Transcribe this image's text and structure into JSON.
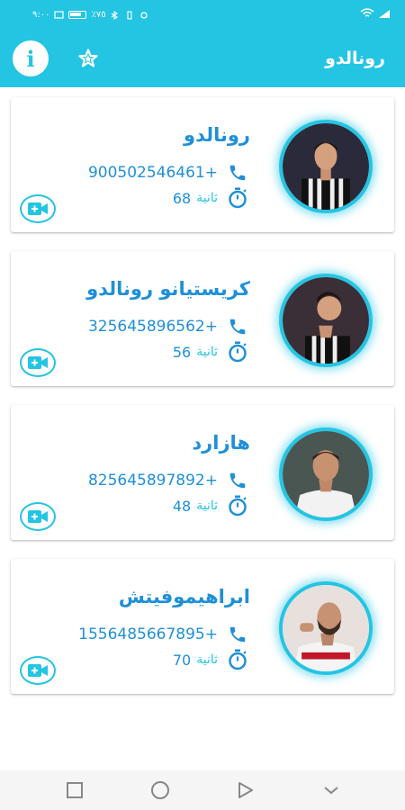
{
  "status_bar": {
    "left_text": "٩:٠٠",
    "carrier_text": "٪٧٥"
  },
  "app_bar": {
    "title": "رونالدو",
    "info_icon": "info-icon",
    "star_icon": "star-outline-icon",
    "info_label": "i"
  },
  "contacts": [
    {
      "name": "رونالدو",
      "phone": "900502546461+",
      "duration": "68",
      "unit": "ثانية",
      "jersey": "juventus"
    },
    {
      "name": "كريستيانو رونالدو",
      "phone": "325645896562+",
      "duration": "56",
      "unit": "ثانية",
      "jersey": "juventus"
    },
    {
      "name": "هازارد",
      "phone": "825645897892+",
      "duration": "48",
      "unit": "ثانية",
      "jersey": "real"
    },
    {
      "name": "ابراهيموفيتش",
      "phone": "1556485667895+",
      "duration": "70",
      "unit": "ثانية",
      "jersey": "milan"
    }
  ],
  "colors": {
    "accent": "#24c4e3",
    "text_blue": "#1f8fd8"
  },
  "nav": [
    "square-icon",
    "circle-icon",
    "triangle-icon",
    "chevron-down-icon"
  ]
}
